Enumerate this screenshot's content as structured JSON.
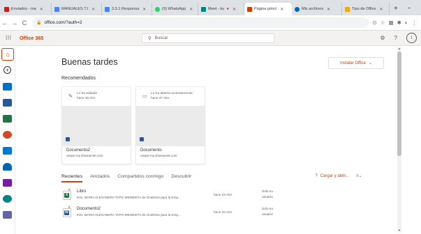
{
  "browser": {
    "tabs": [
      {
        "label": "Enviados - ma",
        "color": "#c5221f"
      },
      {
        "label": "MANUALES T.I",
        "color": "#4285f4"
      },
      {
        "label": "3.3.1 Responsa",
        "color": "#4285f4"
      },
      {
        "label": "(9) WhatsApp",
        "color": "#25d366"
      },
      {
        "label": "Meet - ku",
        "color": "#00897b"
      },
      {
        "label": "Página princi",
        "color": "#d83b01",
        "active": true
      },
      {
        "label": "Mis archivos",
        "color": "#0364b8"
      },
      {
        "label": "Tipo de Office",
        "color": "#f3a712"
      }
    ],
    "new_tab": "+",
    "url": "office.com/?auth=2",
    "window_controls": [
      "−",
      "□",
      "✕"
    ]
  },
  "o365": {
    "brand": "Office 365",
    "search_placeholder": "Buscar",
    "help": "?",
    "avatar": "i"
  },
  "rail": {
    "apps": [
      {
        "name": "outlook",
        "color": "#0072c6"
      },
      {
        "name": "word",
        "color": "#2b579a"
      },
      {
        "name": "excel",
        "color": "#217346"
      },
      {
        "name": "powerpoint",
        "color": "#d24726"
      },
      {
        "name": "onedrive-share",
        "color": "#0078d4"
      },
      {
        "name": "onedrive",
        "color": "#0364b8"
      },
      {
        "name": "onenote",
        "color": "#7719aa"
      },
      {
        "name": "sharepoint",
        "color": "#038387"
      },
      {
        "name": "teams",
        "color": "#6264a7"
      }
    ]
  },
  "main": {
    "greeting": "Buenas tardes",
    "install_label": "Instalar Office",
    "recommended_title": "Recomendados",
    "cards": [
      {
        "meta1": "Lo ha editado",
        "meta2": "hace 46 min",
        "name": "Documento2",
        "location": "uespe-my.sharepoint.com",
        "icon": "pencil-icon"
      },
      {
        "meta1": "Lo ha abierto recientemente",
        "meta2": "hace 47 min",
        "name": "Documento",
        "location": "uespe-my.sharepoint.com",
        "icon": "folder-icon"
      }
    ],
    "tabs": [
      "Recientes",
      "Anclados",
      "Compartidos conmigo",
      "Descubrir"
    ],
    "upload_label": "Cargar y abrir...",
    "files": [
      {
        "name": "Libro",
        "path": "ING. MARIA ALEXANDRA TAPIA MENDIETA de OneDrive para la Emp...",
        "date": "hace 24 min",
        "share1": "Solo su",
        "share2": "usuario",
        "type": "excel",
        "badge": "X",
        "color": "#217346"
      },
      {
        "name": "Documento2",
        "path": "ING. MARIA ALEXANDRA TAPIA MENDIETA de OneDrive para la Emp...",
        "date": "hace 34 min",
        "share1": "Solo su",
        "share2": "usuario",
        "type": "word",
        "badge": "W",
        "color": "#2b579a"
      }
    ]
  }
}
